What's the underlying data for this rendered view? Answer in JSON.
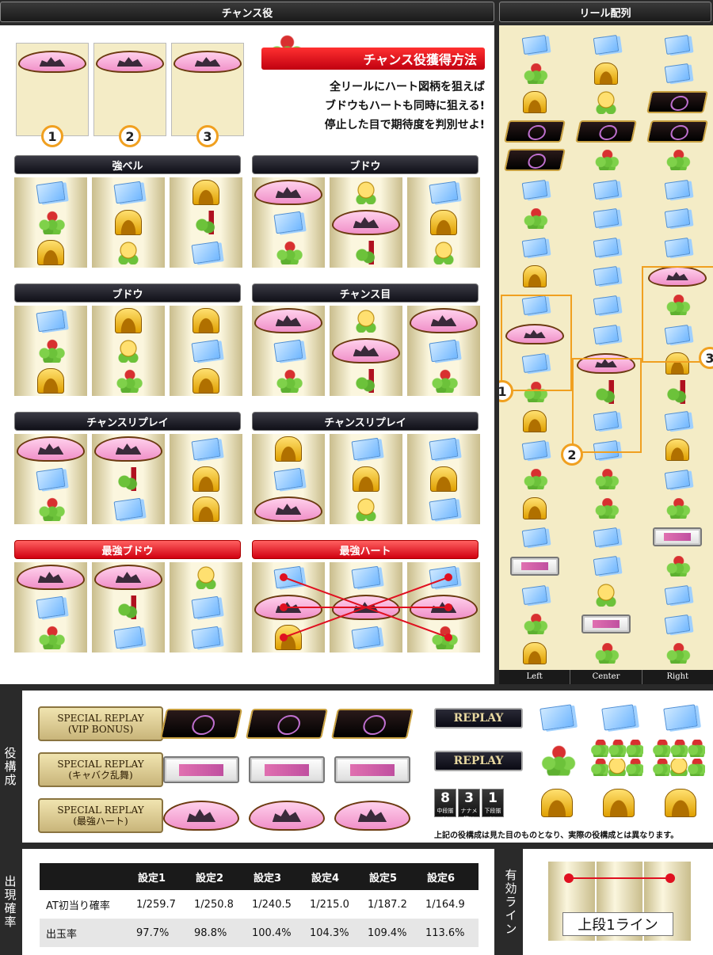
{
  "headers": {
    "chance": "チャンス役",
    "reel": "リール配列"
  },
  "howto": {
    "title": "チャンス役獲得方法",
    "lines": [
      "全リールにハート図柄を狙えば",
      "ブドウもハートも同時に狙える!",
      "停止した目で期待度を判別せよ!"
    ]
  },
  "target_labels": [
    "1",
    "2",
    "3"
  ],
  "sections": [
    {
      "label": "強ベル",
      "style": "dark",
      "reels": [
        [
          "card",
          "grape",
          "bell"
        ],
        [
          "card",
          "bell",
          "trophy"
        ],
        [
          "bell",
          "wine",
          "card"
        ]
      ]
    },
    {
      "label": "ブドウ",
      "style": "dark",
      "reels": [
        [
          "heart",
          "card",
          "grape"
        ],
        [
          "trophy",
          "heart",
          "wine"
        ],
        [
          "card",
          "bell",
          "trophy"
        ]
      ]
    },
    {
      "label": "ブドウ",
      "style": "dark",
      "reels": [
        [
          "card",
          "grape",
          "bell"
        ],
        [
          "bell",
          "trophy",
          "grape"
        ],
        [
          "bell",
          "card",
          "bell"
        ]
      ]
    },
    {
      "label": "チャンス目",
      "style": "dark",
      "reels": [
        [
          "heart",
          "card",
          "grape"
        ],
        [
          "trophy",
          "heart",
          "wine"
        ],
        [
          "heart",
          "card",
          "grape"
        ]
      ]
    },
    {
      "label": "チャンスリプレイ",
      "style": "dark",
      "reels": [
        [
          "heart",
          "card",
          "grape"
        ],
        [
          "heart",
          "wine",
          "card"
        ],
        [
          "card",
          "bell",
          "bell"
        ]
      ]
    },
    {
      "label": "チャンスリプレイ",
      "style": "dark",
      "reels": [
        [
          "bell",
          "card",
          "heart"
        ],
        [
          "card",
          "bell",
          "trophy"
        ],
        [
          "card",
          "bell",
          "card"
        ]
      ]
    },
    {
      "label": "最強ブドウ",
      "style": "red",
      "reels": [
        [
          "heart",
          "card",
          "grape"
        ],
        [
          "heart",
          "wine",
          "card"
        ],
        [
          "trophy",
          "card",
          "card"
        ]
      ]
    },
    {
      "label": "最強ハート",
      "style": "red",
      "reels": [
        [
          "card",
          "heart",
          "bell"
        ],
        [
          "card",
          "heart",
          "card"
        ],
        [
          "card",
          "heart",
          "grape"
        ]
      ]
    }
  ],
  "reel_strip": {
    "left": [
      "card",
      "grape",
      "bell",
      "seven",
      "seven",
      "card",
      "grape",
      "card",
      "bell",
      "card",
      "heart",
      "card",
      "grape",
      "bell",
      "card",
      "grape",
      "bell",
      "card",
      "flag",
      "card",
      "grape",
      "bell"
    ],
    "center": [
      "card",
      "bell",
      "trophy",
      "seven",
      "grape",
      "card",
      "card",
      "card",
      "card",
      "card",
      "card",
      "heart",
      "wine",
      "card",
      "card",
      "grape",
      "grape",
      "card",
      "card",
      "trophy",
      "flag",
      "grape"
    ],
    "right": [
      "card",
      "card",
      "seven",
      "seven",
      "grape",
      "card",
      "card",
      "card",
      "heart",
      "grape",
      "card",
      "bell",
      "wine",
      "card",
      "bell",
      "card",
      "grape",
      "flag",
      "grape",
      "card",
      "card",
      "grape"
    ],
    "column_labels": [
      "Left",
      "Center",
      "Right"
    ],
    "badges": [
      "1",
      "2",
      "3"
    ]
  },
  "yakukousei": {
    "side_label": "役構成",
    "special": [
      {
        "line1": "SPECIAL REPLAY",
        "line2": "(VIP BONUS)",
        "symbol": "seven"
      },
      {
        "line1": "SPECIAL REPLAY",
        "line2": "(キャバク乱舞)",
        "symbol": "flag"
      },
      {
        "line1": "SPECIAL REPLAY",
        "line2": "(最強ハート)",
        "symbol": "heart"
      }
    ],
    "replay_label": "REPLAY",
    "numbers": [
      {
        "n": "8",
        "label": "中段揃い"
      },
      {
        "n": "3",
        "label": "ナナメ揃い"
      },
      {
        "n": "1",
        "label": "下段揃い"
      }
    ],
    "note": "上記の役構成は見た目のものとなり、実際の役構成とは異なります。"
  },
  "probability": {
    "side_label": "出現確率",
    "headers": [
      "",
      "設定1",
      "設定2",
      "設定3",
      "設定4",
      "設定5",
      "設定6"
    ],
    "rows": [
      [
        "AT初当り確率",
        "1/259.7",
        "1/250.8",
        "1/240.5",
        "1/215.0",
        "1/187.2",
        "1/164.9"
      ],
      [
        "出玉率",
        "97.7%",
        "98.8%",
        "100.4%",
        "104.3%",
        "109.4%",
        "113.6%"
      ]
    ]
  },
  "active_line": {
    "side_label": "有効ライン",
    "label": "上段1ライン"
  },
  "colors": {
    "accent_red": "#e01020",
    "orange": "#f0a020",
    "reel_bg": "#f4ecc6"
  }
}
